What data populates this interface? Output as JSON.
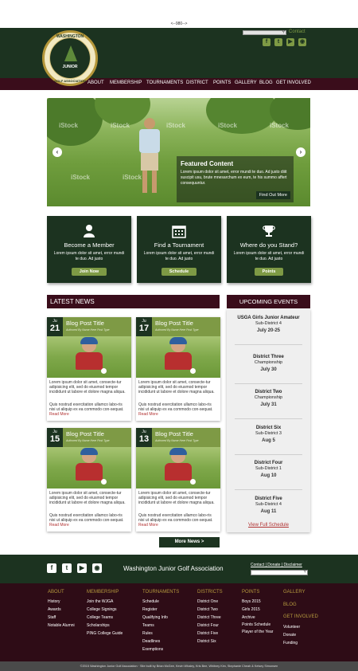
{
  "spec_label": "<--980-->",
  "header": {
    "contact_label": "Contact",
    "search_placeholder": "",
    "social_icons": [
      "facebook-icon",
      "twitter-icon",
      "youtube-icon",
      "instagram-icon"
    ]
  },
  "logo": {
    "top_text": "WASHINGTON",
    "middle_text": "JUNIOR",
    "bottom_text": "GOLF ASSOCIATION"
  },
  "nav": [
    "ABOUT",
    "MEMBERSHIP",
    "TOURNAMENTS",
    "DISTRICT",
    "POINTS",
    "GALLERY",
    "BLOG",
    "GET INVOLVED"
  ],
  "hero": {
    "title": "Featured Content",
    "body": "Lorem ipsum dolor sit amet, error mundi te duo. Ad justo diiit suscipit usu, brute mnesarchum ex eum, te his summo affert consequuntur.",
    "button": "Find Out More",
    "watermark": "iStock"
  },
  "cta": [
    {
      "title": "Become a Member",
      "body": "Lorem ipsum dolor sit amet, error mundi te duo. Ad justo",
      "button": "Join Now",
      "icon": "person-icon"
    },
    {
      "title": "Find a Tournament",
      "body": "Lorem ipsum dolor sit amet, error mundi te duo. Ad justo",
      "button": "Schedule",
      "icon": "calendar-icon"
    },
    {
      "title": "Where do you Stand?",
      "body": "Lorem ipsum dolor sit amet, error mundi te duo. Ad justo",
      "button": "Points",
      "icon": "trophy-icon"
    }
  ],
  "latest_news_title": "LATEST NEWS",
  "upcoming_events_title": "UPCOMING EVENTS",
  "posts": [
    {
      "month": "Ju",
      "day": "21",
      "title": "Blog Post Title",
      "byline": "Authored By Name Here Post Type",
      "text1": "Lorem ipsum dolor sit amet, consecte-tur adipisicing elit, sed do eiusmod tempor incididunt ut labore et dolore magna aliqua.",
      "text2": "Quis nostrud exercitation ullamco labo-ris nisi ut aliquip ex ea commodo con-sequat.",
      "read_more": "Read More"
    },
    {
      "month": "Ju",
      "day": "17",
      "title": "Blog Post Title",
      "byline": "Authored By Name Here Post Type",
      "text1": "Lorem ipsum dolor sit amet, consecte-tur adipisicing elit, sed do eiusmod tempor incididunt ut labore et dolore magna aliqua.",
      "text2": "Quis nostrud exercitation ullamco labo-ris nisi ut aliquip ex ea commodo con-sequat.",
      "read_more": "Read More"
    },
    {
      "month": "Ju",
      "day": "15",
      "title": "Blog Post Title",
      "byline": "Authored By Name Here Post Type",
      "text1": "Lorem ipsum dolor sit amet, consecte-tur adipisicing elit, sed do eiusmod tempor incididunt ut labore et dolore magna aliqua.",
      "text2": "Quis nostrud exercitation ullamco labo-ris nisi ut aliquip ex ea commodo con-sequat.",
      "read_more": "Read More"
    },
    {
      "month": "Ju",
      "day": "13",
      "title": "Blog Post Title",
      "byline": "Authored By Name Here Post Type",
      "text1": "Lorem ipsum dolor sit amet, consecte-tur adipisicing elit, sed do eiusmod tempor incididunt ut labore et dolore magna aliqua.",
      "text2": "Quis nostrud exercitation ullamco labo-ris nisi ut aliquip ex ea commodo con-sequat.",
      "read_more": "Read More"
    }
  ],
  "events": [
    {
      "title": "USGA Girls Junior Amateur",
      "sub": "Sub-District 4",
      "date": "July 20-25"
    },
    {
      "title": "District Three",
      "sub": "Championship",
      "date": "July 30"
    },
    {
      "title": "District Two",
      "sub": "Championship",
      "date": "July 31"
    },
    {
      "title": "District Six",
      "sub": "Sub-District 3",
      "date": "Aug 5"
    },
    {
      "title": "District Four",
      "sub": "Sub-District 1",
      "date": "Aug 10"
    },
    {
      "title": "District Five",
      "sub": "Sub-District 4",
      "date": "Aug 11"
    }
  ],
  "view_full_schedule": "View Full Schedule",
  "more_news": "More News >",
  "footer": {
    "org_name": "Washington Junior Golf Association",
    "links": "Contact | Donate | Disclaimer",
    "columns": [
      {
        "heading": "ABOUT",
        "items": [
          "History",
          "Awards",
          "Staff",
          "Notable Alumni"
        ]
      },
      {
        "heading": "MEMBERSHIP",
        "items": [
          "Join the WJGA",
          "College Signings",
          "College Teams",
          "Scholarships",
          "PING College Guide"
        ]
      },
      {
        "heading": "TOURNAMENTS",
        "items": [
          "Schedule",
          "Register",
          "Qualifying Info",
          "Teams",
          "Rules",
          "Deadlines",
          "Exemptions"
        ]
      },
      {
        "heading": "DISTRICTS",
        "items": [
          "District One",
          "District Two",
          "District Three",
          "District Four",
          "District Five",
          "District Six"
        ]
      },
      {
        "heading": "POINTS",
        "items": [
          "Boys 2015",
          "Girls 2015",
          "Archive",
          "Points Schedule",
          "Player of the Year"
        ]
      }
    ],
    "gallery": "GALLERY",
    "blog": "BLOG",
    "get_involved": "GET INVOLVED",
    "get_involved_items": [
      "Volunteer",
      "Donate",
      "Funding"
    ],
    "copyright": "©2015 Washington Junior Golf Association · Site built by Brian McGee, Kevin Whaley, Kris Bee, Whitney Kim, Stephanie Cheah & Kelsey Simonsen"
  },
  "colors": {
    "dark_green": "#1c3320",
    "maroon": "#3a0d1b",
    "olive": "#7e9a45",
    "gold": "#b59a3e"
  }
}
